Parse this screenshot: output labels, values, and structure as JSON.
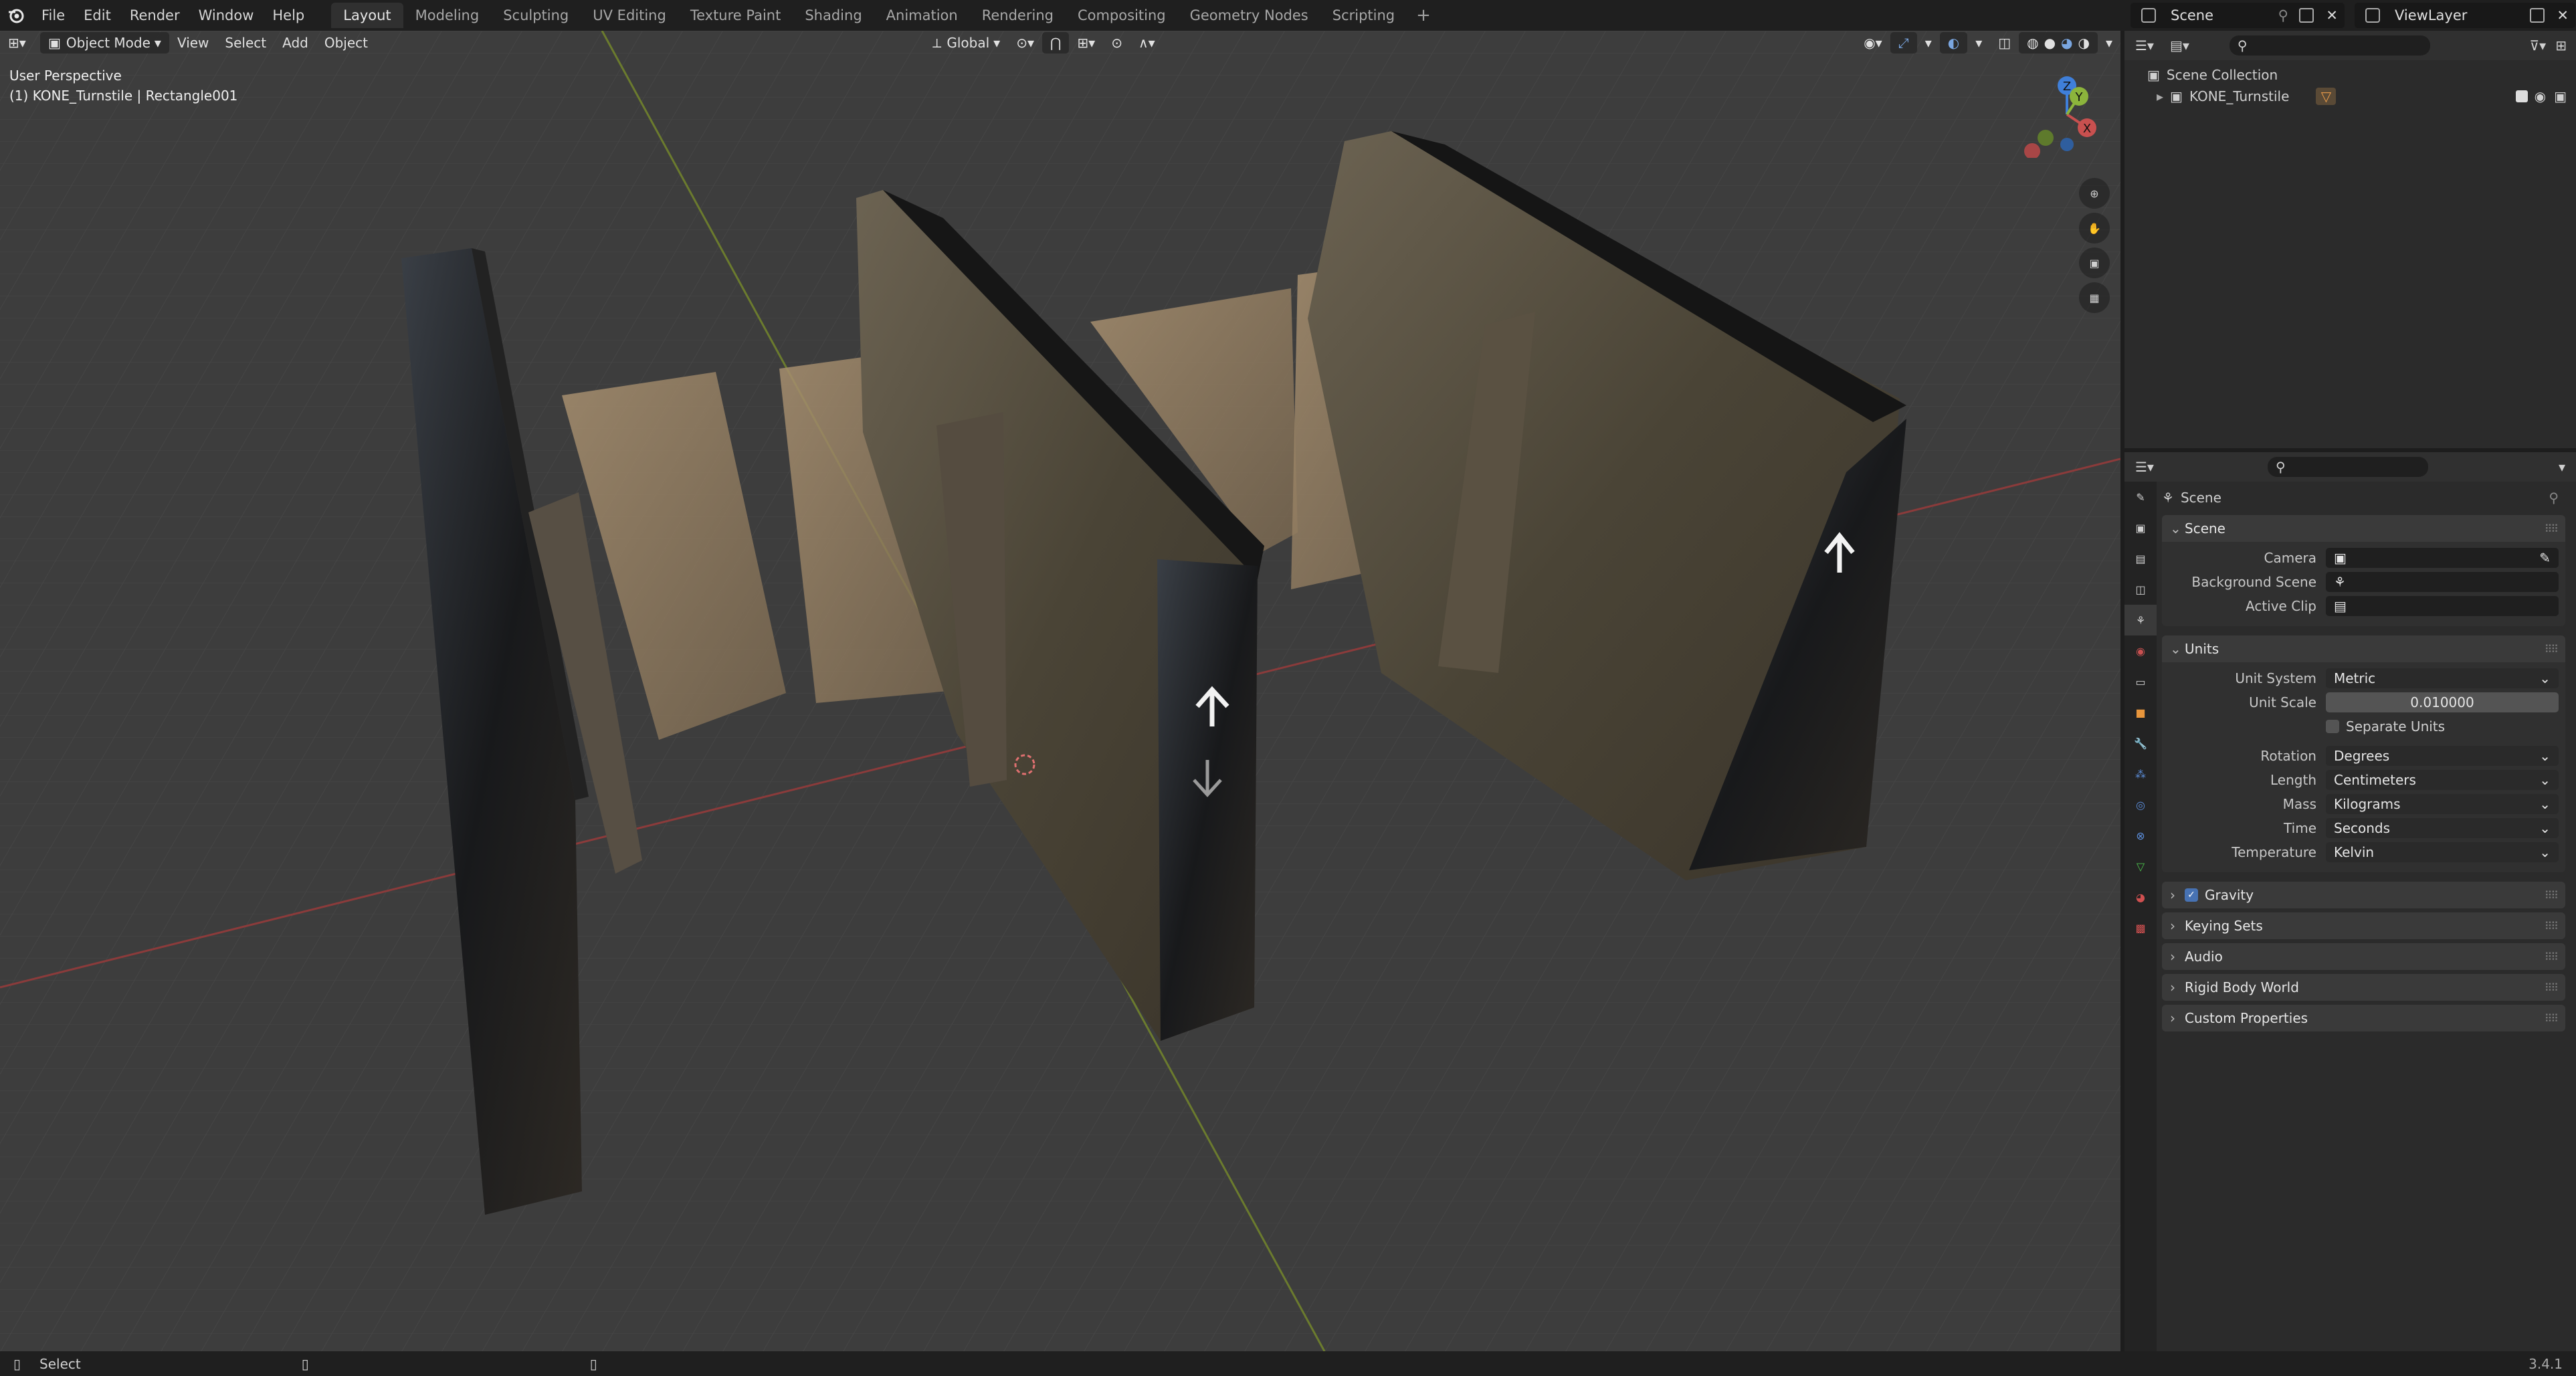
{
  "topbar": {
    "menus": [
      "File",
      "Edit",
      "Render",
      "Window",
      "Help"
    ],
    "workspaces": [
      "Layout",
      "Modeling",
      "Sculpting",
      "UV Editing",
      "Texture Paint",
      "Shading",
      "Animation",
      "Rendering",
      "Compositing",
      "Geometry Nodes",
      "Scripting"
    ],
    "active_workspace": "Layout",
    "add_tab": "+",
    "scene": "Scene",
    "view_layer": "ViewLayer"
  },
  "viewport": {
    "mode": "Object Mode",
    "menus": [
      "View",
      "Select",
      "Add",
      "Object"
    ],
    "transform_orientation": "Global",
    "perspective": "User Perspective",
    "active_object": "(1) KONE_Turnstile | Rectangle001",
    "gizmo_axes": [
      "X",
      "Y",
      "Z"
    ]
  },
  "outliner": {
    "root": "Scene Collection",
    "items": [
      {
        "label": "KONE_Turnstile"
      }
    ]
  },
  "properties": {
    "context": "Scene",
    "scene_panel": {
      "title": "Scene",
      "camera_label": "Camera",
      "background_label": "Background Scene",
      "clip_label": "Active Clip"
    },
    "units_panel": {
      "title": "Units",
      "unit_system_label": "Unit System",
      "unit_system": "Metric",
      "unit_scale_label": "Unit Scale",
      "unit_scale": "0.010000",
      "separate_units": "Separate Units",
      "rotation_label": "Rotation",
      "rotation": "Degrees",
      "length_label": "Length",
      "length": "Centimeters",
      "mass_label": "Mass",
      "mass": "Kilograms",
      "time_label": "Time",
      "time": "Seconds",
      "temperature_label": "Temperature",
      "temperature": "Kelvin"
    },
    "collapsed": [
      "Gravity",
      "Keying Sets",
      "Audio",
      "Rigid Body World",
      "Custom Properties"
    ]
  },
  "statusbar": {
    "action": "Select",
    "version": "3.4.1"
  },
  "colors": {
    "accent": "#4772b3",
    "x_axis": "#c8504f",
    "y_axis": "#8cb43c",
    "z_axis": "#3f7fd9"
  }
}
